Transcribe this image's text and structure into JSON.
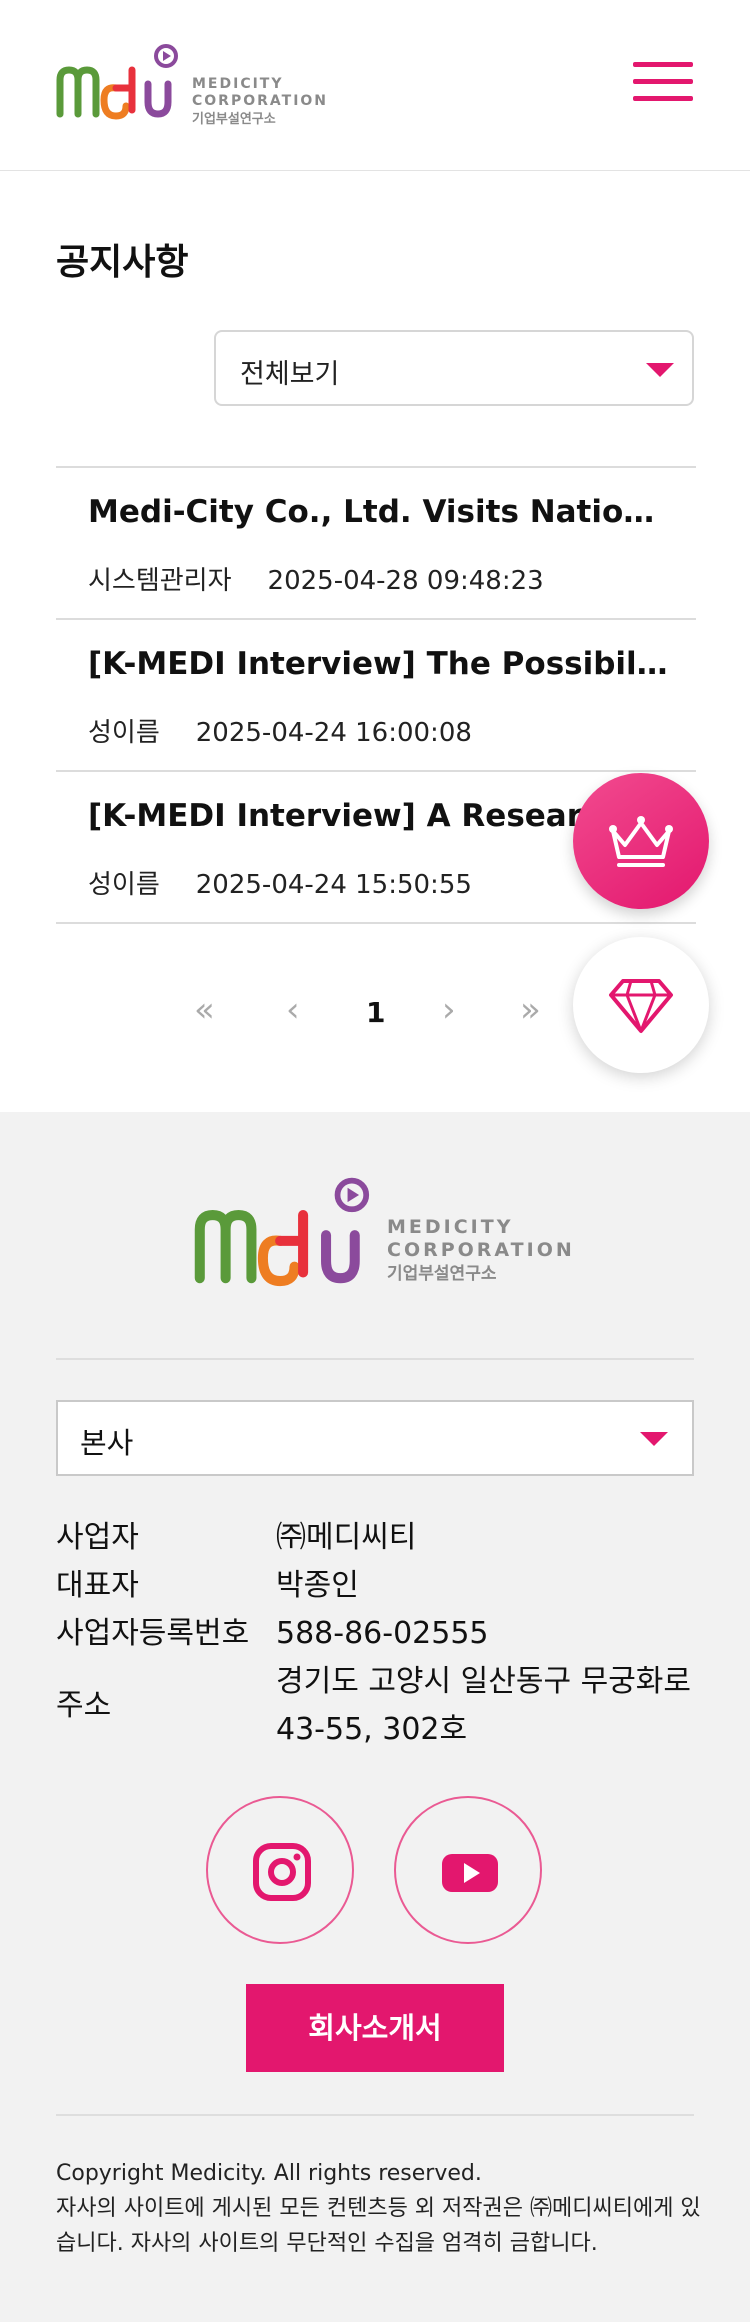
{
  "header": {
    "logo_line1": "MEDICITY",
    "logo_line2": "CORPORATION",
    "logo_line3": "기업부설연구소",
    "menu_icon": "hamburger-menu-icon"
  },
  "page_title": "공지사항",
  "filter": {
    "selected": "전체보기"
  },
  "notices": [
    {
      "title": "Medi-City Co., Ltd. Visits National University",
      "author": "시스템관리자",
      "date": "2025-04-28 09:48:23"
    },
    {
      "title": "[K-MEDI Interview] The Possibility of Medical",
      "author": "성이름",
      "date": "2025-04-24 16:00:08"
    },
    {
      "title": "[K-MEDI Interview] A Researcher",
      "author": "성이름",
      "date": "2025-04-24 15:50:55"
    }
  ],
  "pagination": {
    "first": "«",
    "prev": "‹",
    "current": "1",
    "next": "›",
    "last": "»"
  },
  "floating": {
    "crown_icon": "crown-icon",
    "gem_icon": "diamond-icon"
  },
  "footer": {
    "logo_line1": "MEDICITY",
    "logo_line2": "CORPORATION",
    "logo_line3": "기업부설연구소",
    "branch": "본사",
    "info": [
      {
        "key": "사업자",
        "value": "㈜메디씨티"
      },
      {
        "key": "대표자",
        "value": "박종인"
      },
      {
        "key": "사업자등록번호",
        "value": "588-86-02555"
      },
      {
        "key": "주소",
        "value": "경기도 고양시 일산동구 무궁화로 43-55, 302호"
      }
    ],
    "social": [
      "instagram-icon",
      "youtube-icon"
    ],
    "brochure_label": "회사소개서",
    "copyright": "Copyright Medicity. All rights reserved.",
    "notice_text": "자사의 사이트에 게시된 모든 컨텐츠등 외 저작권은 ㈜메디씨티에게 있습니다. 자사의 사이트의 무단적인 수집을 엄격히 금합니다."
  },
  "colors": {
    "accent": "#e3176e",
    "footer_bg": "#f2f2f2"
  }
}
